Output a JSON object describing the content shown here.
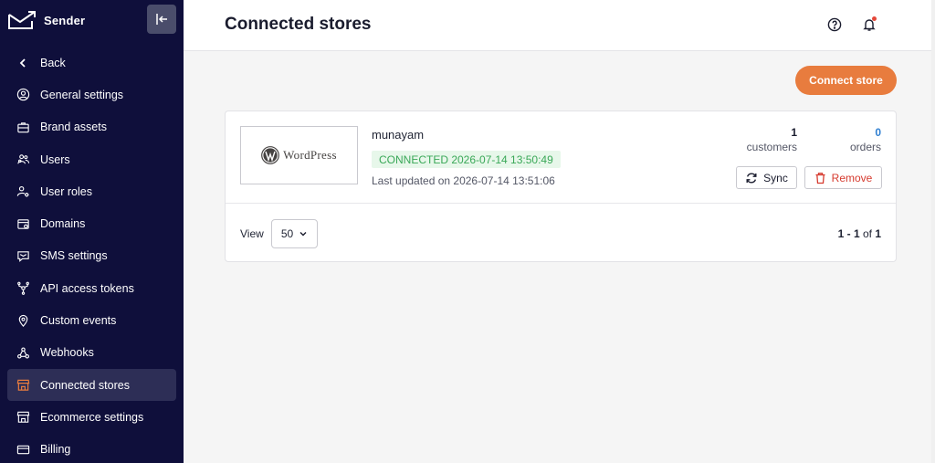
{
  "app": {
    "name": "Sender"
  },
  "sidebar": {
    "items": [
      {
        "label": "Back",
        "icon": "chevron-left-icon"
      },
      {
        "label": "General settings",
        "icon": "user-circle-icon"
      },
      {
        "label": "Brand assets",
        "icon": "briefcase-icon"
      },
      {
        "label": "Users",
        "icon": "users-icon"
      },
      {
        "label": "User roles",
        "icon": "user-gear-icon"
      },
      {
        "label": "Domains",
        "icon": "domain-icon"
      },
      {
        "label": "SMS settings",
        "icon": "sms-icon"
      },
      {
        "label": "API access tokens",
        "icon": "api-icon"
      },
      {
        "label": "Custom events",
        "icon": "map-pin-icon"
      },
      {
        "label": "Webhooks",
        "icon": "webhook-icon"
      },
      {
        "label": "Connected stores",
        "icon": "store-icon",
        "active": true
      },
      {
        "label": "Ecommerce settings",
        "icon": "store-settings-icon"
      },
      {
        "label": "Billing",
        "icon": "credit-card-icon"
      }
    ]
  },
  "header": {
    "title": "Connected stores"
  },
  "actions": {
    "connect_store": "Connect store"
  },
  "store": {
    "logo_text": "WordPress",
    "name": "munayam",
    "status": "CONNECTED 2026-07-14 13:50:49",
    "last_updated": "Last updated on 2026-07-14 13:51:06",
    "customers_count": "1",
    "customers_label": "customers",
    "orders_count": "0",
    "orders_label": "orders",
    "sync_label": "Sync",
    "remove_label": "Remove"
  },
  "pagination": {
    "view_label": "View",
    "page_size": "50",
    "range_start": "1",
    "range_sep": " - ",
    "range_end": "1",
    "of_label": " of ",
    "total": "1"
  },
  "colors": {
    "sidebar_bg": "#0f0f3b",
    "active_item_bg": "#2d2e56",
    "accent_orange": "#e87c3e",
    "connected_green": "#3aa858",
    "orders_blue": "#2f7fd1",
    "remove_red": "#d63b2f"
  }
}
